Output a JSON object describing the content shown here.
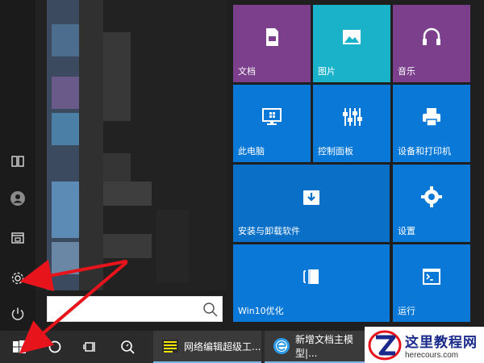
{
  "tiles": [
    {
      "label": "文档",
      "icon": "document-icon",
      "color": "#7b3f8c"
    },
    {
      "label": "图片",
      "icon": "picture-icon",
      "color": "#1ab2c9"
    },
    {
      "label": "音乐",
      "icon": "headphones-icon",
      "color": "#7b3f8c"
    },
    {
      "label": "此电脑",
      "icon": "monitor-icon",
      "color": "#0a78d7"
    },
    {
      "label": "控制面板",
      "icon": "sliders-icon",
      "color": "#0a78d7"
    },
    {
      "label": "设备和打印机",
      "icon": "printer-icon",
      "color": "#0a78d7"
    },
    {
      "label": "安装与卸载软件",
      "icon": "install-box-icon",
      "color": "#0a6fc7"
    },
    {
      "label": "设置",
      "icon": "gear-icon",
      "color": "#0a78d7"
    },
    {
      "label": "Win10优化",
      "icon": "win10-optimize-icon",
      "color": "#0a78d7"
    },
    {
      "label": "运行",
      "icon": "run-icon",
      "color": "#0a78d7"
    }
  ],
  "search": {
    "placeholder": "",
    "value": ""
  },
  "taskbar": {
    "app1_label": "网络编辑超级工...",
    "app2_label": "新增文档主模型|..."
  },
  "watermark": {
    "title": "这里教程网",
    "url": "herecours.com"
  },
  "colors": {
    "arrow": "#e8141c",
    "tile_blue": "#0a78d7",
    "tile_purple": "#7b3f8c",
    "tile_teal": "#1ab2c9"
  }
}
